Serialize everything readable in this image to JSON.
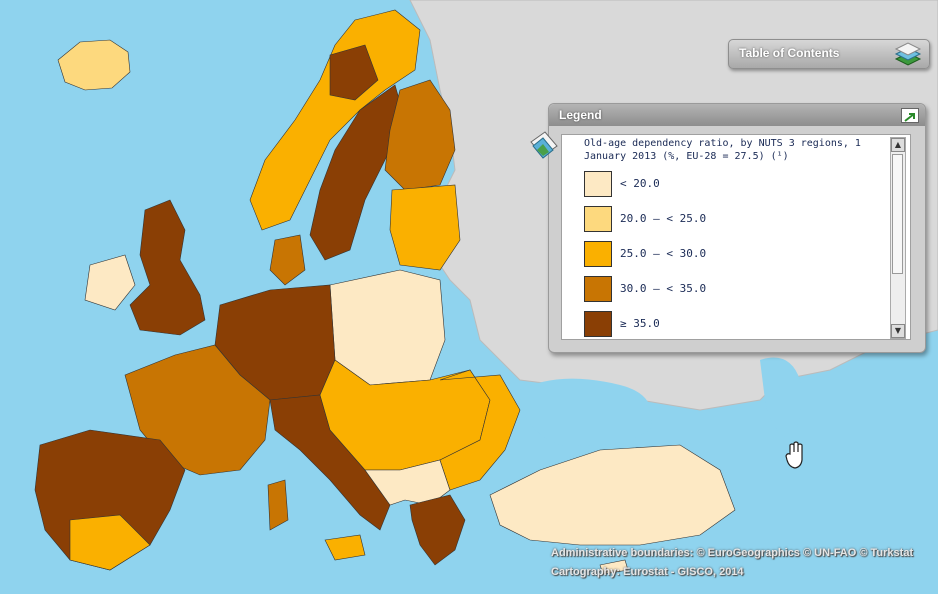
{
  "toc": {
    "label": "Table of Contents"
  },
  "legend": {
    "title": "Legend",
    "description": "Old-age dependency ratio, by NUTS 3 regions, 1 January 2013 (%, EU-28 = 27.5) (¹)",
    "items": [
      {
        "label": "< 20.0",
        "color": "#fde9c4"
      },
      {
        "label": "20.0 – < 25.0",
        "color": "#fdd97e"
      },
      {
        "label": "25.0 – < 30.0",
        "color": "#fab000"
      },
      {
        "label": "30.0 – < 35.0",
        "color": "#c87503"
      },
      {
        "label": "≥ 35.0",
        "color": "#8a3f05"
      }
    ]
  },
  "credits": {
    "line1": "Administrative boundaries: © EuroGeographics © UN-FAO © Turkstat",
    "line2": "Cartography: Eurostat - GISCO, 2014"
  },
  "colors": {
    "sea": "#8fd3ee",
    "non_eu_land": "#d9d9d9"
  }
}
